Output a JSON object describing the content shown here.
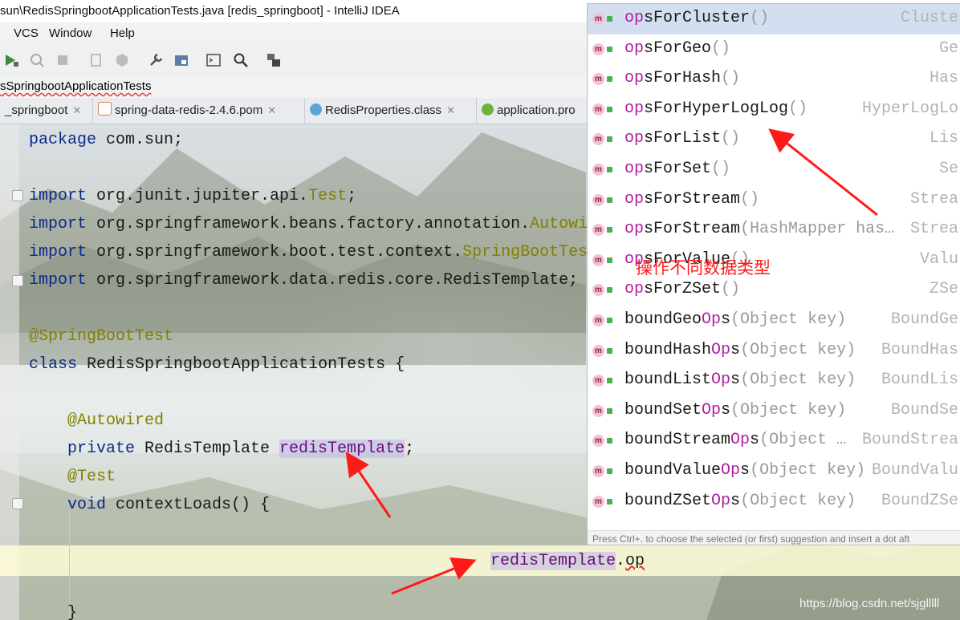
{
  "window": {
    "title": "sun\\RedisSpringbootApplicationTests.java [redis_springboot] - IntelliJ IDEA"
  },
  "menu": {
    "items": [
      "VCS",
      "Window",
      "Help"
    ]
  },
  "breadcrumb": {
    "label": "sSpringbootApplicationTests"
  },
  "tabs": [
    {
      "label": "_springboot",
      "icon": "none"
    },
    {
      "label": "spring-data-redis-2.4.6.pom",
      "icon": "maven-icon"
    },
    {
      "label": "RedisProperties.class",
      "icon": "class-icon"
    },
    {
      "label": "application.pro",
      "icon": "spring-icon"
    }
  ],
  "code": {
    "line1_kw": "package",
    "line1_rest": " com.sun;",
    "import_kw": "import",
    "imp1_pkg": " org.junit.jupiter.api.",
    "imp1_cls": "Test",
    "imp1_end": ";",
    "imp2_pkg": " org.springframework.beans.factory.annotation.",
    "imp2_cls": "Autowi",
    "imp3_pkg": " org.springframework.boot.test.context.",
    "imp3_cls": "SpringBootTes",
    "imp4_pkg": " org.springframework.data.redis.core.RedisTemplate;",
    "ann_class": "@SpringBootTest",
    "class_kw": "class",
    "class_rest": " RedisSpringbootApplicationTests {",
    "ann_field": "@Autowired",
    "private_kw": "private",
    "field_type": " RedisTemplate ",
    "field_name": "redisTemplate",
    "field_end": ";",
    "ann_test": "@Test",
    "void_kw": "void",
    "method_rest": " contextLoads() {",
    "cur_field": "redisTemplate",
    "cur_dot": ".",
    "cur_typed": "op",
    "close": "}"
  },
  "completion": {
    "items": [
      {
        "m": "op",
        "rest": "sForCluster",
        "params": "()",
        "type": "Cluste"
      },
      {
        "m": "op",
        "rest": "sForGeo",
        "params": "()",
        "type": "Ge"
      },
      {
        "m": "op",
        "rest": "sForHash",
        "params": "()",
        "type": "Has"
      },
      {
        "m": "op",
        "rest": "sForHyperLogLog",
        "params": "()",
        "type": "HyperLogLo"
      },
      {
        "m": "op",
        "rest": "sForList",
        "params": "()",
        "type": "Lis"
      },
      {
        "m": "op",
        "rest": "sForSet",
        "params": "()",
        "type": "Se"
      },
      {
        "m": "op",
        "rest": "sForStream",
        "params": "()",
        "type": "Strea"
      },
      {
        "m": "op",
        "rest": "sForStream",
        "params": "(HashMapper has…",
        "type": "Strea"
      },
      {
        "m": "op",
        "rest": "sForValue",
        "params": "()",
        "type": "Valu"
      },
      {
        "m": "op",
        "rest": "sForZSet",
        "params": "()",
        "type": "ZSe"
      },
      {
        "pre": "boundGeo",
        "m": "Op",
        "rest": "s",
        "params": "(Object key)",
        "type": "BoundGe"
      },
      {
        "pre": "boundHash",
        "m": "Op",
        "rest": "s",
        "params": "(Object key)",
        "type": "BoundHas"
      },
      {
        "pre": "boundList",
        "m": "Op",
        "rest": "s",
        "params": "(Object key)",
        "type": "BoundLis"
      },
      {
        "pre": "boundSet",
        "m": "Op",
        "rest": "s",
        "params": "(Object key)",
        "type": "BoundSe"
      },
      {
        "pre": "boundStream",
        "m": "Op",
        "rest": "s",
        "params": "(Object …",
        "type": "BoundStrea"
      },
      {
        "pre": "boundValue",
        "m": "Op",
        "rest": "s",
        "params": "(Object key)",
        "type": "BoundValu"
      },
      {
        "pre": "boundZSet",
        "m": "Op",
        "rest": "s",
        "params": "(Object key)",
        "type": "BoundZSe"
      }
    ],
    "method_badge": "m",
    "hint": "Press Ctrl+. to choose the selected (or first) suggestion and insert a dot aft"
  },
  "annotation": {
    "text": "操作不同数据类型",
    "color": "#ff1a1a"
  },
  "watermark": "https://blog.csdn.net/sjglllll"
}
